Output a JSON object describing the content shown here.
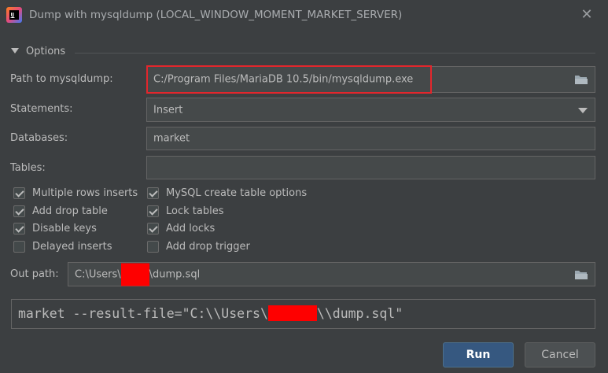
{
  "window": {
    "title": "Dump with mysqldump (LOCAL_WINDOW_MOMENT_MARKET_SERVER)",
    "app_icon": "intellij-app-icon",
    "close_icon": "close-icon"
  },
  "options": {
    "section_label": "Options",
    "path_label": "Path to mysqldump:",
    "path_value": "C:/Program Files/MariaDB 10.5/bin/mysqldump.exe",
    "statements_label": "Statements:",
    "statements_value": "Insert",
    "databases_label": "Databases:",
    "databases_value": "market",
    "tables_label": "Tables:",
    "tables_value": "",
    "checkboxes_left": [
      {
        "label": "Multiple rows inserts",
        "checked": true
      },
      {
        "label": "Add drop table",
        "checked": true
      },
      {
        "label": "Disable keys",
        "checked": true
      },
      {
        "label": "Delayed inserts",
        "checked": false
      }
    ],
    "checkboxes_right": [
      {
        "label": "MySQL create table options",
        "checked": true
      },
      {
        "label": "Lock tables",
        "checked": true
      },
      {
        "label": "Add locks",
        "checked": true
      },
      {
        "label": "Add drop trigger",
        "checked": false
      }
    ],
    "out_path_label": "Out path:",
    "out_path_prefix": "C:\\Users\\",
    "out_path_suffix": "\\dump.sql"
  },
  "command": {
    "prefix": "market --result-file=\"C:\\\\Users\\",
    "suffix": "\\\\dump.sql\""
  },
  "buttons": {
    "run": "Run",
    "cancel": "Cancel"
  },
  "colors": {
    "background": "#3c3f41",
    "accent": "#365880",
    "highlight_border": "#e3262c",
    "redaction": "#fe0000"
  }
}
